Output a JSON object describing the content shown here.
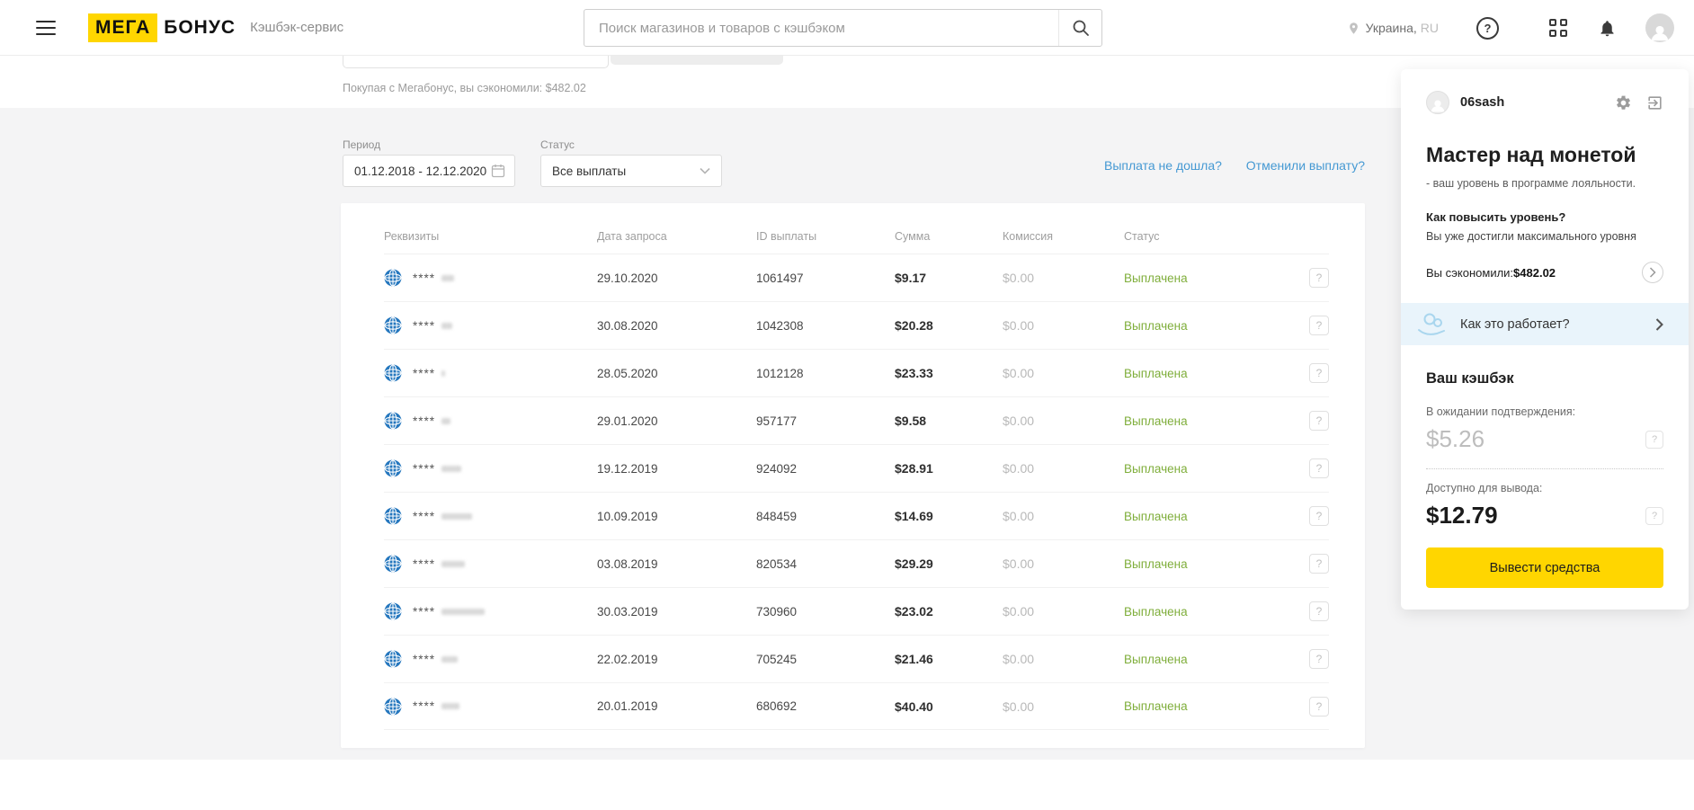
{
  "header": {
    "logo": {
      "part1": "МЕГА",
      "part2": "БОНУС",
      "tagline": "Кэшбэк-сервис"
    },
    "search_placeholder": "Поиск магазинов и товаров с кэшбэком",
    "location": {
      "city": "Украина,",
      "lang": "RU"
    }
  },
  "icons": {
    "question": "?"
  },
  "savings_note": "Покупая с Мегабонус, вы сэкономили: $482.02",
  "filters": {
    "period_label": "Период",
    "period_value": "01.12.2018 - 12.12.2020",
    "status_label": "Статус",
    "status_value": "Все выплаты",
    "link_not_arrived": "Выплата не дошла?",
    "link_cancelled": "Отменили выплату?"
  },
  "table": {
    "columns": [
      "Реквизиты",
      "Дата запроса",
      "ID выплаты",
      "Сумма",
      "Комиссия",
      "Статус"
    ],
    "rows": [
      {
        "requisite": "****",
        "redact_w": 14,
        "date": "29.10.2020",
        "id": "1061497",
        "sum": "$9.17",
        "fee": "$0.00",
        "status": "Выплачена"
      },
      {
        "requisite": "****",
        "redact_w": 12,
        "date": "30.08.2020",
        "id": "1042308",
        "sum": "$20.28",
        "fee": "$0.00",
        "status": "Выплачена"
      },
      {
        "requisite": "****",
        "redact_w": 4,
        "date": "28.05.2020",
        "id": "1012128",
        "sum": "$23.33",
        "fee": "$0.00",
        "status": "Выплачена"
      },
      {
        "requisite": "****",
        "redact_w": 10,
        "date": "29.01.2020",
        "id": "957177",
        "sum": "$9.58",
        "fee": "$0.00",
        "status": "Выплачена"
      },
      {
        "requisite": "****",
        "redact_w": 22,
        "date": "19.12.2019",
        "id": "924092",
        "sum": "$28.91",
        "fee": "$0.00",
        "status": "Выплачена"
      },
      {
        "requisite": "****",
        "redact_w": 34,
        "date": "10.09.2019",
        "id": "848459",
        "sum": "$14.69",
        "fee": "$0.00",
        "status": "Выплачена"
      },
      {
        "requisite": "****",
        "redact_w": 26,
        "date": "03.08.2019",
        "id": "820534",
        "sum": "$29.29",
        "fee": "$0.00",
        "status": "Выплачена"
      },
      {
        "requisite": "****",
        "redact_w": 48,
        "date": "30.03.2019",
        "id": "730960",
        "sum": "$23.02",
        "fee": "$0.00",
        "status": "Выплачена"
      },
      {
        "requisite": "****",
        "redact_w": 18,
        "date": "22.02.2019",
        "id": "705245",
        "sum": "$21.46",
        "fee": "$0.00",
        "status": "Выплачена"
      },
      {
        "requisite": "****",
        "redact_w": 20,
        "date": "20.01.2019",
        "id": "680692",
        "sum": "$40.40",
        "fee": "$0.00",
        "status": "Выплачена"
      }
    ]
  },
  "profile": {
    "username": "06sash",
    "level_title": "Мастер над монетой",
    "level_subtitle": "- ваш уровень в программе лояльности.",
    "raise_title": "Как повысить уровень?",
    "raise_text": "Вы уже достигли максимального уровня",
    "saved_label": "Вы сэкономили:",
    "saved_value": "$482.02",
    "how_it_works": "Как это работает?",
    "cashback_title": "Ваш кэшбэк",
    "pending_label": "В ожидании подтверждения:",
    "pending_value": "$5.26",
    "available_label": "Доступно для вывода:",
    "available_value": "$12.79",
    "withdraw_button": "Вывести средства"
  },
  "colors": {
    "brand_yellow": "#ffd600",
    "link_blue": "#4599d3",
    "status_green": "#7fae3b",
    "webmoney_blue": "#2577be",
    "page_bg": "#f4f4f5"
  }
}
